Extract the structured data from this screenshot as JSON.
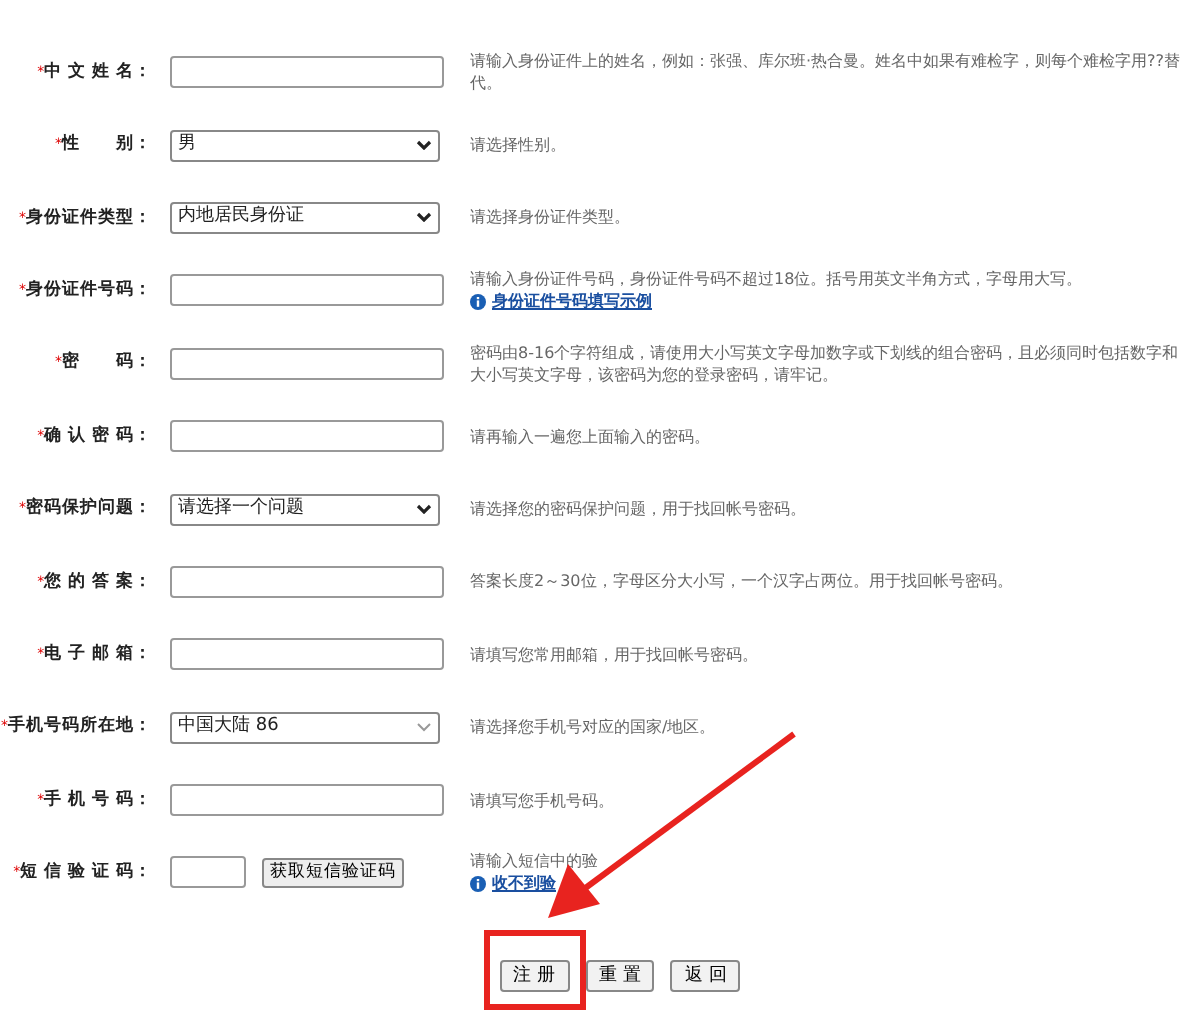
{
  "fields": [
    {
      "kind": "text",
      "required": "*",
      "label": "中 文 姓 名：",
      "hint": "请输入身份证件上的姓名，例如：张强、库尔班·热合曼。姓名中如果有难检字，则每个难检字用??替代。"
    },
    {
      "kind": "select",
      "required": "*",
      "label": "性　　别：",
      "value": "男",
      "hint": "请选择性别。"
    },
    {
      "kind": "select",
      "required": "*",
      "label": "身份证件类型：",
      "value": "内地居民身份证",
      "hint": "请选择身份证件类型。"
    },
    {
      "kind": "text",
      "required": "*",
      "label": "身份证件号码：",
      "hint": "请输入身份证件号码，身份证件号码不超过18位。括号用英文半角方式，字母用大写。",
      "link": "身份证件号码填写示例"
    },
    {
      "kind": "text",
      "required": "*",
      "label": "密　　码：",
      "hint": "密码由8-16个字符组成，请使用大小写英文字母加数字或下划线的组合密码，且必须同时包括数字和大小写英文字母，该密码为您的登录密码，请牢记。"
    },
    {
      "kind": "text",
      "required": "*",
      "label": "确 认 密 码：",
      "hint": "请再输入一遍您上面输入的密码。"
    },
    {
      "kind": "select",
      "required": "*",
      "label": "密码保护问题：",
      "value": "请选择一个问题",
      "hint": "请选择您的密码保护问题，用于找回帐号密码。"
    },
    {
      "kind": "text",
      "required": "*",
      "label": "您 的 答 案：",
      "hint": "答案长度2～30位，字母区分大小写，一个汉字占两位。用于找回帐号密码。"
    },
    {
      "kind": "text",
      "required": "*",
      "label": "电 子 邮 箱：",
      "hint": "请填写您常用邮箱，用于找回帐号密码。"
    },
    {
      "kind": "combo",
      "required": "*",
      "label": "手机号码所在地：",
      "value": "中国大陆 86",
      "hint": "请选择您手机号对应的国家/地区。"
    },
    {
      "kind": "text",
      "required": "*",
      "label": "手 机 号 码：",
      "hint": "请填写您手机号码。"
    },
    {
      "kind": "sms",
      "required": "*",
      "label": "短 信 验 证 码：",
      "button": "获取短信验证码",
      "hint": "请输入短信中的验",
      "link": "收不到验"
    }
  ],
  "buttons": [
    {
      "label": "注 册",
      "highlighted": true
    },
    {
      "label": "重 置",
      "highlighted": false
    },
    {
      "label": "返 回",
      "highlighted": false
    }
  ]
}
